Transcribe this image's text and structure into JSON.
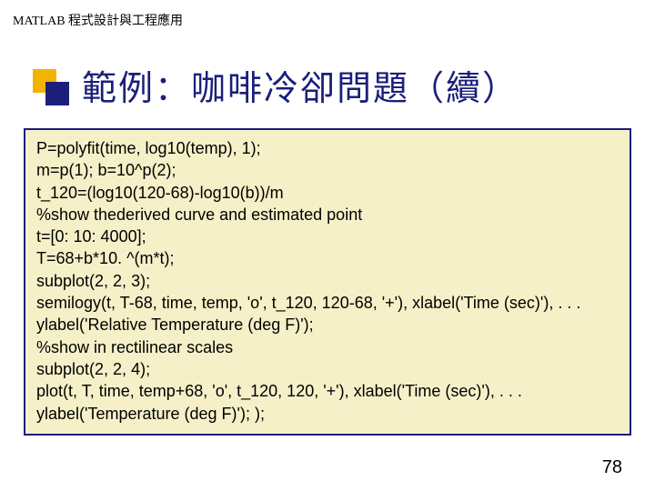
{
  "header": "MATLAB 程式設計與工程應用",
  "title": "範例：咖啡冷卻問題（續）",
  "code": {
    "l1": "P=polyfit(time, log10(temp), 1);",
    "l2": "m=p(1); b=10^p(2);",
    "l3": "t_120=(log10(120-68)-log10(b))/m",
    "l4": "%show thederived curve and estimated point",
    "l5": "t=[0: 10: 4000];",
    "l6": "T=68+b*10. ^(m*t);",
    "l7": "subplot(2, 2, 3);",
    "l8": "semilogy(t, T-68, time, temp, 'o', t_120, 120-68, '+'), xlabel('Time (sec)'), . . .",
    "l9": "ylabel('Relative Temperature (deg F)');",
    "l10": "%show in rectilinear scales",
    "l11": "subplot(2, 2, 4);",
    "l12": "plot(t, T, time, temp+68, 'o', t_120, 120, '+'), xlabel('Time (sec)'), . . .",
    "l13": "ylabel('Temperature (deg F)'); );"
  },
  "page_number": "78"
}
